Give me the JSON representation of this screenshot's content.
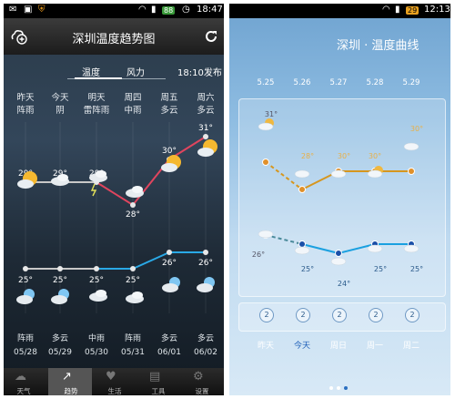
{
  "left": {
    "status_time": "18:47",
    "battery": "88",
    "title": "深圳温度趋势图",
    "tabs": [
      "温度",
      "风力"
    ],
    "publish": "18:10发布",
    "days": [
      {
        "day": "昨天",
        "weather": "阵雨"
      },
      {
        "day": "今天",
        "weather": "阴"
      },
      {
        "day": "明天",
        "weather": "雷阵雨"
      },
      {
        "day": "周四",
        "weather": "中雨"
      },
      {
        "day": "周五",
        "weather": "多云"
      },
      {
        "day": "周六",
        "weather": "多云"
      }
    ],
    "high_labels": [
      "29°",
      "29°",
      "29°",
      "28°",
      "30°",
      "31°"
    ],
    "low_labels": [
      "25°",
      "25°",
      "25°",
      "25°",
      "26°",
      "26°"
    ],
    "night_weather": [
      "阵雨",
      "多云",
      "中雨",
      "阵雨",
      "多云",
      "多云"
    ],
    "dates": [
      "05/28",
      "05/29",
      "05/30",
      "05/31",
      "06/01",
      "06/02"
    ],
    "nav": [
      "天气",
      "趋势",
      "生活",
      "工具",
      "设置"
    ],
    "colors": {
      "high": "#e0455e",
      "low": "#2aa9e6",
      "past": "#c8c8c8"
    }
  },
  "right": {
    "status_time": "12:13",
    "battery": "29",
    "title": "深圳 · 温度曲线",
    "dates": [
      "5.25",
      "5.26",
      "5.27",
      "5.28",
      "5.29"
    ],
    "high_labels": [
      "31°",
      "28°",
      "30°",
      "30°",
      "30°"
    ],
    "low_labels": [
      "26°",
      "25°",
      "24°",
      "25°",
      "25°"
    ],
    "wind_levels": [
      "2",
      "2",
      "2",
      "2",
      "2"
    ],
    "days": [
      "昨天",
      "今天",
      "周日",
      "周一",
      "周二"
    ],
    "colors": {
      "high": "#d6961e",
      "low": "#1aa0e0",
      "past": "#4a8a9a"
    }
  },
  "chart_data": [
    {
      "type": "line",
      "categories": [
        "05/28",
        "05/29",
        "05/30",
        "05/31",
        "06/01",
        "06/02"
      ],
      "series": [
        {
          "values": [
            29,
            29,
            29,
            28,
            30,
            31
          ]
        },
        {
          "values": [
            25,
            25,
            25,
            25,
            26,
            26
          ]
        }
      ]
    },
    {
      "type": "line",
      "categories": [
        "5.25",
        "5.26",
        "5.27",
        "5.28",
        "5.29"
      ],
      "series": [
        {
          "values": [
            31,
            28,
            30,
            30,
            30
          ]
        },
        {
          "values": [
            26,
            25,
            24,
            25,
            25
          ]
        }
      ]
    }
  ]
}
